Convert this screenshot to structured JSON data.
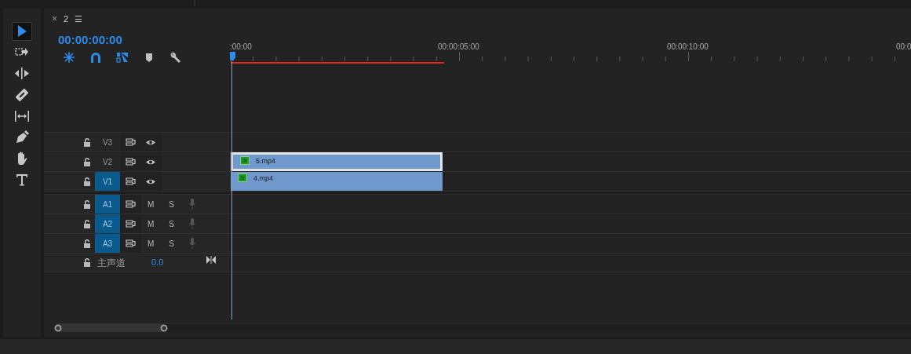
{
  "tools": [
    {
      "kind": "selection",
      "selected": true
    },
    {
      "kind": "track-select",
      "selected": false
    },
    {
      "kind": "ripple",
      "selected": false
    },
    {
      "kind": "razor",
      "selected": false
    },
    {
      "kind": "slip",
      "selected": false
    },
    {
      "kind": "pen",
      "selected": false
    },
    {
      "kind": "hand",
      "selected": false
    },
    {
      "kind": "type",
      "selected": false
    }
  ],
  "panel": {
    "close": "×",
    "title": "2",
    "menu": "☰"
  },
  "timecode": "00:00:00:00",
  "timeline_tools": [
    {
      "kind": "nest",
      "on": true
    },
    {
      "kind": "snap",
      "on": true
    },
    {
      "kind": "linked",
      "on": true
    },
    {
      "kind": "marker",
      "on": false
    },
    {
      "kind": "settings",
      "on": false
    }
  ],
  "ruler": {
    "labels": [
      ":00:00",
      "00:00:05:00",
      "00:00:10:00",
      "00:0"
    ]
  },
  "video_tracks": [
    {
      "name": "V3",
      "targeted": false
    },
    {
      "name": "V2",
      "targeted": false,
      "clip": {
        "name": "5.mp4",
        "fx": "fx",
        "selected": true
      }
    },
    {
      "name": "V1",
      "targeted": true,
      "clip": {
        "name": "4.mp4",
        "fx": "fx",
        "selected": false
      }
    }
  ],
  "audio_tracks": [
    {
      "name": "A1",
      "targeted": true,
      "mute": "M",
      "solo": "S"
    },
    {
      "name": "A2",
      "targeted": true,
      "mute": "M",
      "solo": "S"
    },
    {
      "name": "A3",
      "targeted": true,
      "mute": "M",
      "solo": "S"
    }
  ],
  "master": {
    "name": "主声道",
    "value": "0.0"
  }
}
